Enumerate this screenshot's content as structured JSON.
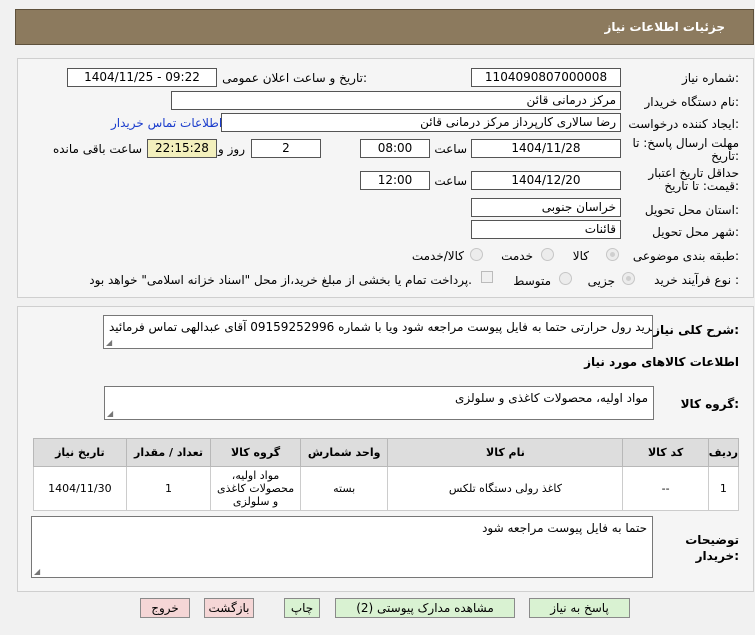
{
  "header": {
    "title": "جزئیات اطلاعات نیاز"
  },
  "form": {
    "need_number_label": "شماره نیاز:",
    "need_number": "1104090807000008",
    "announce_label": "تاریخ و ساعت اعلان عمومی:",
    "announce_value": "1404/11/25 - 09:22",
    "buyer_org_label": "نام دستگاه خریدار:",
    "buyer_org": "مرکز درمانی قائن",
    "creator_label": "ایجاد کننده درخواست:",
    "creator": "رضا سالاری کارپرداز مرکز درمانی قائن",
    "contact_link": "اطلاعات تماس خریدار",
    "deadline_label": "مهلت ارسال پاسخ: تا تاریخ:",
    "deadline_date": "1404/11/28",
    "time_label": "ساعت",
    "deadline_time": "08:00",
    "days_value": "2",
    "days_label": "روز و",
    "remaining_time": "22:15:28",
    "remaining_label": "ساعت باقی مانده",
    "validity_label": "حداقل تاریخ اعتبار قیمت: تا تاریخ:",
    "validity_date": "1404/12/20",
    "validity_time": "12:00",
    "province_label": "استان محل تحویل:",
    "province": "خراسان جنوبی",
    "city_label": "شهر محل تحویل:",
    "city": "قائنات",
    "category_label": "طبقه بندی موضوعی:",
    "category_options": [
      "کالا",
      "خدمت",
      "کالا/خدمت"
    ],
    "purchase_type_label": "نوع فرآیند خرید :",
    "purchase_options": [
      "جزیی",
      "متوسط"
    ],
    "payment_note": "پرداخت تمام یا بخشی از مبلغ خرید،از محل \"اسناد خزانه اسلامی\" خواهد بود."
  },
  "details": {
    "desc_label": "شرح کلی نیاز:",
    "desc_text": "خرید رول حرارتی حتما به فایل پیوست مراجعه شود ویا با شماره 09159252996 آقای عبدالهی تماس فرمائید",
    "goods_info_title": "اطلاعات کالاهای مورد نیاز",
    "goods_group_label": "گروه کالا:",
    "goods_group_value": "مواد اولیه، محصولات کاغذی و سلولزی",
    "table_headers": [
      "ردیف",
      "کد کالا",
      "نام کالا",
      "واحد شمارش",
      "گروه کالا",
      "تعداد / مقدار",
      "تاریخ نیاز"
    ],
    "table_rows": [
      {
        "row": "1",
        "code": "--",
        "name": "کاغذ رولی دستگاه تلکس",
        "unit": "بسته",
        "group": "مواد اولیه، محصولات کاغذی و سلولزی",
        "qty": "1",
        "date": "1404/11/30"
      }
    ],
    "buyer_notes_label": "توضیحات خریدار:",
    "buyer_notes": "حتما به فایل پیوست مراجعه شود"
  },
  "buttons": {
    "reply": "پاسخ به نیاز",
    "docs": "مشاهده مدارک پیوستی (2)",
    "print": "چاپ",
    "back": "بازگشت",
    "exit": "خروج"
  }
}
